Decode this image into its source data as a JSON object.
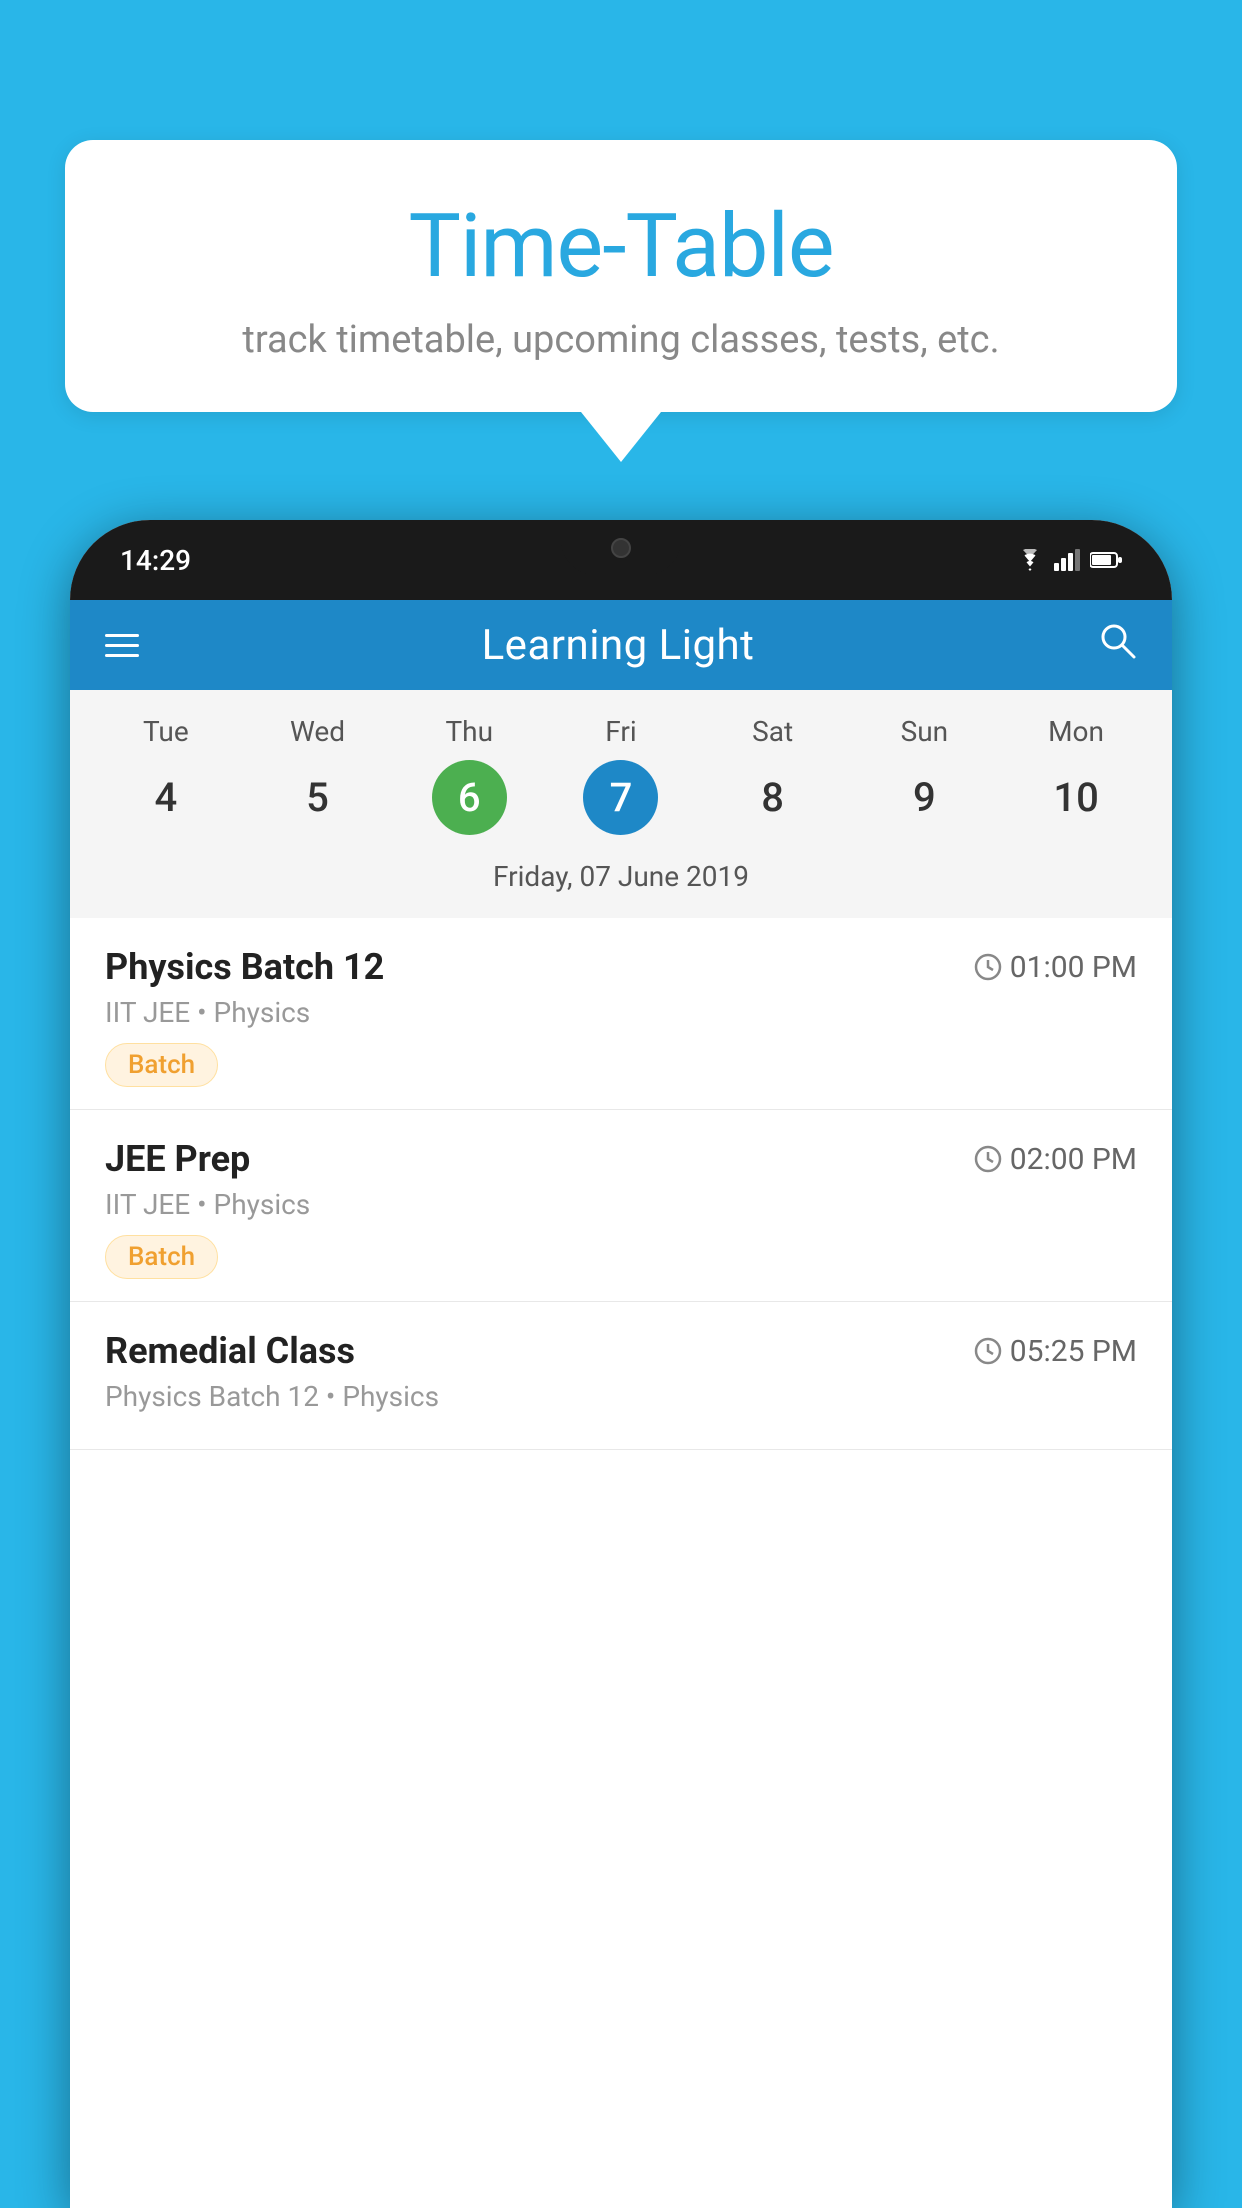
{
  "background_color": "#29b6e8",
  "speech_bubble": {
    "title": "Time-Table",
    "subtitle": "track timetable, upcoming classes, tests, etc."
  },
  "phone": {
    "status_bar": {
      "time": "14:29",
      "icons": [
        "wifi",
        "signal",
        "battery"
      ]
    },
    "app_header": {
      "title": "Learning Light",
      "menu_icon": "hamburger-icon",
      "search_icon": "search-icon"
    },
    "calendar": {
      "days": [
        {
          "label": "Tue",
          "number": "4",
          "state": "normal"
        },
        {
          "label": "Wed",
          "number": "5",
          "state": "normal"
        },
        {
          "label": "Thu",
          "number": "6",
          "state": "today"
        },
        {
          "label": "Fri",
          "number": "7",
          "state": "selected"
        },
        {
          "label": "Sat",
          "number": "8",
          "state": "normal"
        },
        {
          "label": "Sun",
          "number": "9",
          "state": "normal"
        },
        {
          "label": "Mon",
          "number": "10",
          "state": "normal"
        }
      ],
      "selected_date_label": "Friday, 07 June 2019"
    },
    "schedule": [
      {
        "title": "Physics Batch 12",
        "time": "01:00 PM",
        "subtitle": "IIT JEE • Physics",
        "tag": "Batch"
      },
      {
        "title": "JEE Prep",
        "time": "02:00 PM",
        "subtitle": "IIT JEE • Physics",
        "tag": "Batch"
      },
      {
        "title": "Remedial Class",
        "time": "05:25 PM",
        "subtitle": "Physics Batch 12 • Physics",
        "tag": null
      }
    ]
  }
}
